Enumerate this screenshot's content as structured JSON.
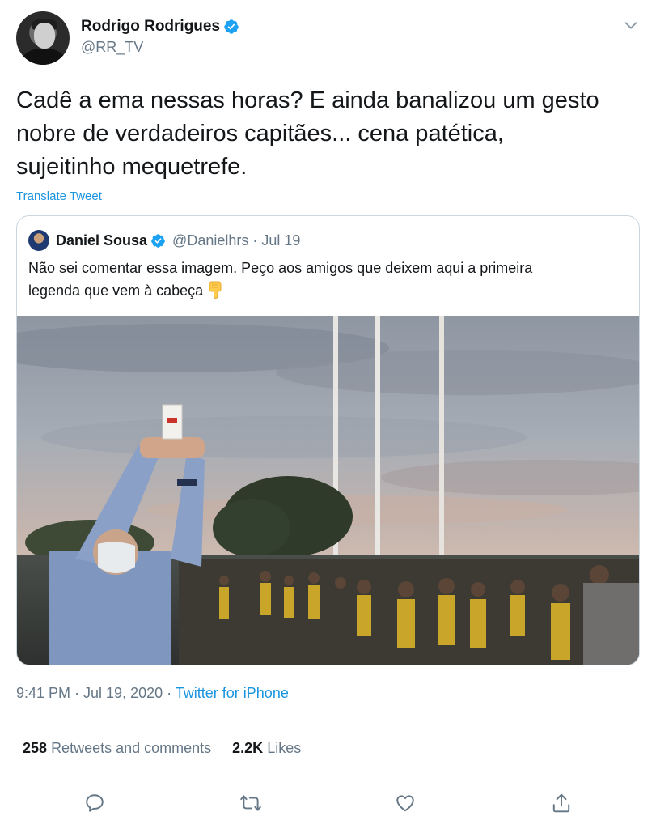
{
  "tweet": {
    "author": {
      "display_name": "Rodrigo Rodrigues",
      "handle": "@RR_TV",
      "verified": true
    },
    "text_lines": [
      "Cadê a ema nessas horas? E ainda banalizou um gesto",
      "nobre de verdadeiros capitães... cena patética,",
      "sujeitinho mequetrefe."
    ],
    "translate_label": "Translate Tweet",
    "quoted": {
      "display_name": "Daniel Sousa",
      "handle_date": "@Danielhrs · Jul 19",
      "text_line1": "Não sei comentar essa imagem. Peço aos amigos que deixem aqui a primeira",
      "text_line2": "legenda que vem à cabeça",
      "emoji": "backhand-index-pointing-down"
    },
    "timestamp": "9:41 PM · Jul 19, 2020 · ",
    "source": "Twitter for iPhone",
    "stats": {
      "retweets_count": "258",
      "retweets_label": "Retweets and comments",
      "likes_count": "2.2K",
      "likes_label": "Likes"
    },
    "icons": {
      "reply": "reply-icon",
      "retweet": "retweet-icon",
      "like": "heart-icon",
      "share": "share-icon",
      "more": "chevron-down-icon"
    },
    "colors": {
      "link": "#1b95e0",
      "verified": "#1da1f2",
      "muted": "#657786",
      "text": "#14171a"
    }
  }
}
